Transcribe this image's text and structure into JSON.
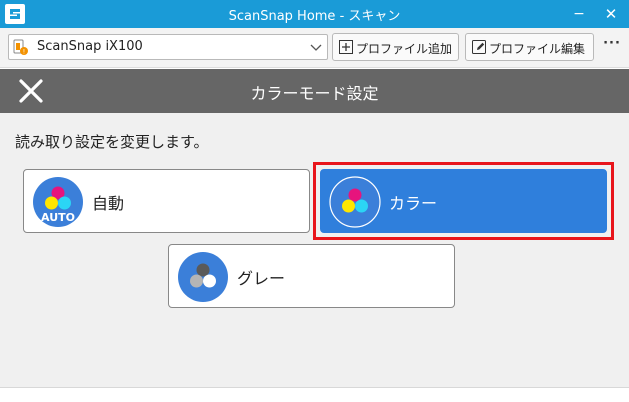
{
  "window": {
    "title": "ScanSnap Home - スキャン",
    "minimize_symbol": "−",
    "close_symbol": "✕"
  },
  "toolbar": {
    "scanner_name": "ScanSnap iX100",
    "add_profile_label": "プロファイル追加",
    "edit_profile_label": "プロファイル編集",
    "more_label": "···"
  },
  "header": {
    "title": "カラーモード設定"
  },
  "content": {
    "instruction": "読み取り設定を変更します。",
    "modes": [
      {
        "label": "自動",
        "icon": "auto-color-mode-icon",
        "badge": "AUTO",
        "selected": false
      },
      {
        "label": "カラー",
        "icon": "color-mode-icon",
        "selected": true
      },
      {
        "label": "グレー",
        "icon": "gray-mode-icon",
        "selected": false
      }
    ]
  },
  "colors": {
    "titlebar": "#1a9bd7",
    "header": "#666666",
    "selected_button": "#2f7fdc",
    "highlight_border": "#e8151b",
    "magenta": "#e6147d",
    "yellow": "#ffe600",
    "cyan": "#2bd5f5"
  }
}
